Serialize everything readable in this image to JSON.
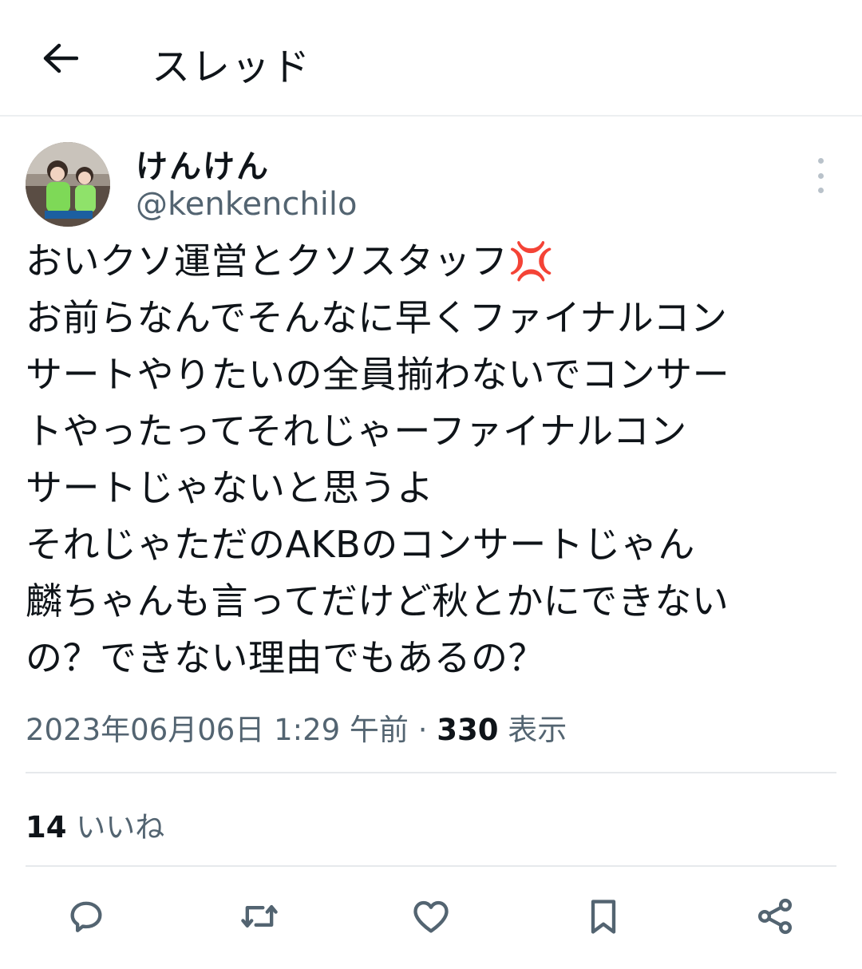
{
  "header": {
    "back_icon": "arrow-left-icon",
    "title": "スレッド"
  },
  "tweet": {
    "author": {
      "display_name": "けんけん",
      "handle": "@kenkenchilo"
    },
    "more_icon": "more-vertical-icon",
    "lines": [
      "おいクソ運営とクソスタッフ💢",
      "お前らなんでそんなに早くファイナルコン",
      "サートやりたいの全員揃わないでコンサー",
      "トやったってそれじゃーファイナルコン",
      "サートじゃないと思うよ",
      "それじゃただのAKBのコンサートじゃん",
      "麟ちゃんも言ってだけど秋とかにできない",
      "の？できない理由でもあるの？"
    ],
    "meta": {
      "timestamp": "2023年06月06日 1:29 午前",
      "separator": "·",
      "views_count": "330",
      "views_label": "表示"
    },
    "likes": {
      "count": "14",
      "label": "いいね"
    }
  },
  "actions": [
    {
      "icon": "reply-icon"
    },
    {
      "icon": "retweet-icon"
    },
    {
      "icon": "like-icon"
    },
    {
      "icon": "bookmark-icon"
    },
    {
      "icon": "share-icon"
    }
  ],
  "colors": {
    "text": "#0f1419",
    "secondary": "#536471",
    "divider": "#e6e9ec"
  }
}
